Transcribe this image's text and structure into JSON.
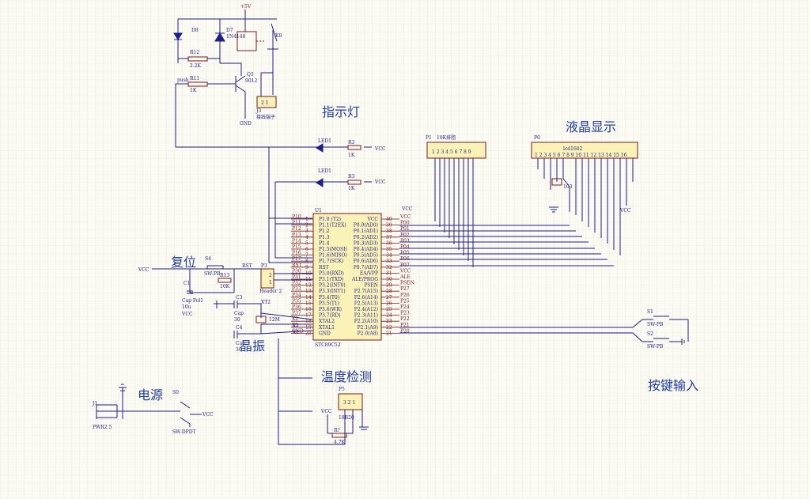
{
  "sections": {
    "relay": "指示灯",
    "lcd": "液晶显示",
    "reset": "复位",
    "crystal": "晶振",
    "temp": "温度检测",
    "power": "电源",
    "keys": "按键输入"
  },
  "relay_block": {
    "vcc": "+5V",
    "d8": "D8",
    "d7": "D7",
    "d7_part": "1N4148",
    "r12": "R12",
    "r12_val": "2.2K",
    "r11": "R11",
    "r11_val": "1K",
    "push": "push",
    "q3": "Q3",
    "q3_part": "9012",
    "k8": "K8",
    "j3": "J3",
    "j3_desc": "接线端子",
    "j3_pins": "2 1",
    "gnd": "GND"
  },
  "leds": [
    {
      "ref": "LED1",
      "r": "R3",
      "rval": "1K",
      "vcc": "VCC"
    },
    {
      "ref": "LED1",
      "r": "R3",
      "rval": "1K",
      "vcc": "VCC"
    }
  ],
  "p1": {
    "ref": "P1",
    "desc": "10K排阻",
    "pins": "1 2 3 4 5 6 7 8 9"
  },
  "p0": {
    "ref": "P0",
    "desc": "lcd1602",
    "pins": "1 2 3 4 5 6 7 8 9 10 11 12 13 14 15 16",
    "pot_val": "103",
    "vcc": "VCC"
  },
  "mcu": {
    "ref": "U1",
    "part": "STC89C52",
    "top_vcc": "VCC",
    "left_nets": [
      "P10",
      "P11",
      "P12",
      "P13",
      "P14",
      "P15",
      "P16",
      "P17",
      "RST",
      "P30",
      "P31",
      "P32",
      "P33",
      "P34",
      "P35",
      "P36",
      "P37",
      "X2",
      "X1",
      "GND"
    ],
    "left_pins": [
      "1",
      "2",
      "3",
      "4",
      "5",
      "6",
      "7",
      "8",
      "9",
      "10",
      "11",
      "12",
      "13",
      "14",
      "15",
      "16",
      "17",
      "18",
      "19",
      "20"
    ],
    "left_labels": [
      "P1.0 (T2)",
      "P1.1(T2EX)",
      "P1.2",
      "P1.3",
      "P1.4",
      "P1.5(MOSI)",
      "P1.6(MISO)",
      "P1.7(SCK)",
      "RST",
      "P3.0(RXD)",
      "P3.1(TXD)",
      "P3.2(INT0)",
      "P3.3(INT1)",
      "P3.4(T0)",
      "P3.5(T1)",
      "P3.6(WR)",
      "P3.7(RD)",
      "XTAL2",
      "XTAL1",
      "GND"
    ],
    "right_labels": [
      "VCC",
      "P0.0(AD0)",
      "P0.1(AD1)",
      "P0.2(AD2)",
      "P0.3(AD3)",
      "P0.4(AD4)",
      "P0.5(AD5)",
      "P0.6(AD6)",
      "P0.7(AD7)",
      "EA/VPP",
      "ALE/PROG",
      "PSEN",
      "P2.7(A15)",
      "P2.6(A14)",
      "P2.5(A13)",
      "P2.4(A12)",
      "P2.3(A11)",
      "P2.2(A10)",
      "P2.1(A9)",
      "P2.0(A8)"
    ],
    "right_pins": [
      "40",
      "39",
      "38",
      "37",
      "36",
      "35",
      "34",
      "33",
      "32",
      "31",
      "30",
      "29",
      "28",
      "27",
      "26",
      "25",
      "24",
      "23",
      "22",
      "21"
    ],
    "right_nets": [
      "VCC",
      "P00",
      "P01",
      "P02",
      "P03",
      "P04",
      "P05",
      "P06",
      "P07",
      "VCC",
      "ALE",
      "PSEN",
      "P27",
      "P26",
      "P25",
      "P24",
      "P23",
      "P22",
      "P21",
      "P20"
    ]
  },
  "reset_block": {
    "vcc": "VCC",
    "s4": "S4",
    "s4_part": "SW-PB",
    "r13": "R13",
    "r13_val": "10K",
    "rst": "RST",
    "c1": "C1",
    "c1_part": "Cap Pol1",
    "c1_val": "10u",
    "vcc2": "VCC",
    "p3": "P3",
    "p3_part": "Header 2",
    "p3_pins": [
      "2",
      "1"
    ]
  },
  "xtal_block": {
    "c3": "C3",
    "c3_part": "Cap",
    "c3_val": "30",
    "c4": "C4",
    "c4_part": "Cap",
    "c4_val": "30",
    "xt": "XT2",
    "xt_val": "12M",
    "x2": "X2",
    "x1": "X1"
  },
  "temp_block": {
    "p5": "P5",
    "part": "18B20",
    "pins": "3 2 1",
    "vcc": "VCC",
    "r": "R?",
    "rval": "4.7K"
  },
  "power_block": {
    "j1": "J1",
    "j1_part": "PWR2.5",
    "s0": "S0",
    "s0_part": "SW-DPDT",
    "vcc": "VCC"
  },
  "keys_block": {
    "s1": "S1",
    "s1_part": "SW-PB",
    "s2": "S2",
    "s2_part": "SW-PB"
  }
}
